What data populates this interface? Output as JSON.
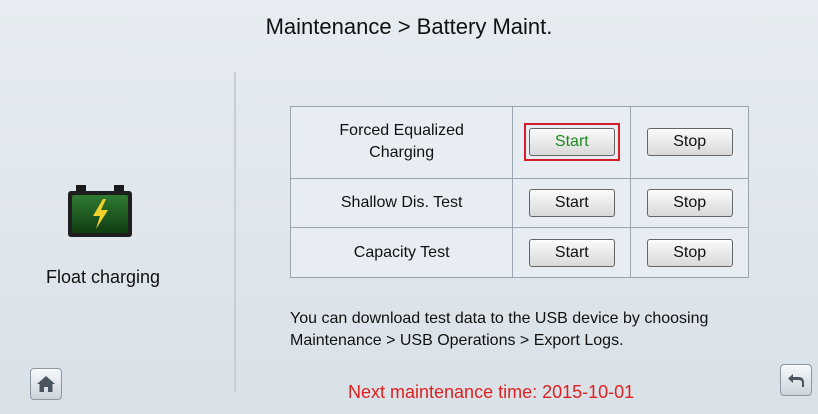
{
  "header": {
    "title": "Maintenance > Battery Maint."
  },
  "status": {
    "battery_icon": "battery-charging-icon",
    "label": "Float charging"
  },
  "operations": {
    "rows": [
      {
        "name": "Forced Equalized\nCharging",
        "start": "Start",
        "stop": "Stop",
        "highlighted": true
      },
      {
        "name": "Shallow Dis. Test",
        "start": "Start",
        "stop": "Stop",
        "highlighted": false
      },
      {
        "name": "Capacity Test",
        "start": "Start",
        "stop": "Stop",
        "highlighted": false
      }
    ]
  },
  "info": {
    "text": "You can download test data to the USB device by choosing Maintenance > USB Operations > Export Logs.",
    "next_maintenance": "Next maintenance time: 2015-10-01"
  },
  "nav": {
    "home_icon": "home-icon",
    "back_icon": "back-arrow-icon"
  },
  "colors": {
    "highlight": "#d41f2b",
    "next_time": "#e02020",
    "start_active": "#1d8a1d"
  }
}
